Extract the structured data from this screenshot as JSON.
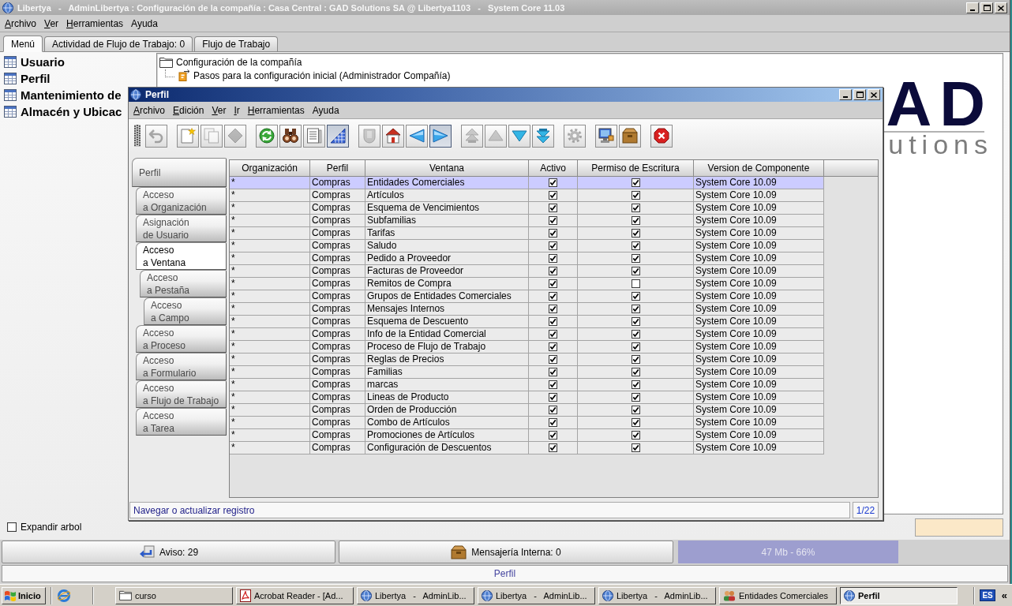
{
  "window": {
    "title": "Libertya   -   AdminLibertya : Configuración de la compañía : Casa Central : GAD Solutions SA @ Libertya1103   -   System Core 11.03",
    "menu": [
      {
        "label": "Archivo",
        "mnemonic": true
      },
      {
        "label": "Ver",
        "mnemonic": true
      },
      {
        "label": "Herramientas",
        "mnemonic": true
      },
      {
        "label": "Ayuda",
        "mnemonic": false
      }
    ]
  },
  "tabs": [
    {
      "label": "Menú",
      "selected": true
    },
    {
      "label": "Actividad de Flujo de Trabajo: 0",
      "selected": false
    },
    {
      "label": "Flujo de Trabajo",
      "selected": false
    }
  ],
  "menu_panel": {
    "favorites": [
      {
        "label": "Usuario"
      },
      {
        "label": "Perfil"
      },
      {
        "label": "Mantenimiento de"
      },
      {
        "label": "Almacén y Ubicac"
      }
    ],
    "tree": [
      {
        "label": "Configuración de la compañía",
        "kind": "folder",
        "children": [
          {
            "label": "Pasos para la configuración inicial (Administrador Compañía)",
            "kind": "process"
          }
        ]
      }
    ],
    "logo": {
      "mark": "AD",
      "tagline": "utions"
    },
    "expand_tree": {
      "label": "Expandir arbol",
      "checked": false
    }
  },
  "status_buttons": [
    {
      "label": "Aviso: 29",
      "kind": "notice"
    },
    {
      "label": "Mensajería Interna: 0",
      "kind": "messages"
    }
  ],
  "memory": {
    "reading": "47 Mb - 66%"
  },
  "status_line": "Perfil",
  "child_window": {
    "title": "Perfil",
    "menu": [
      {
        "label": "Archivo",
        "mnemonic": true
      },
      {
        "label": "Edición",
        "mnemonic": true
      },
      {
        "label": "Ver",
        "mnemonic": true
      },
      {
        "label": "Ir",
        "mnemonic": true
      },
      {
        "label": "Herramientas",
        "mnemonic": true
      },
      {
        "label": "Ayuda",
        "mnemonic": false
      }
    ],
    "toolbar": [
      [
        {
          "kind": "undo",
          "disabled": true,
          "pressed": false
        }
      ],
      [
        {
          "kind": "new",
          "disabled": false,
          "pressed": false
        },
        {
          "kind": "copy",
          "disabled": true,
          "pressed": false
        },
        {
          "kind": "delete",
          "disabled": true,
          "pressed": false
        }
      ],
      [
        {
          "kind": "refresh",
          "disabled": false,
          "pressed": false
        },
        {
          "kind": "find",
          "disabled": false,
          "pressed": false
        },
        {
          "kind": "history",
          "disabled": false,
          "pressed": false
        },
        {
          "kind": "grid",
          "disabled": false,
          "pressed": true
        }
      ],
      [
        {
          "kind": "attachment",
          "disabled": true,
          "pressed": false
        },
        {
          "kind": "home",
          "disabled": false,
          "pressed": false
        },
        {
          "kind": "parent",
          "disabled": false,
          "pressed": false
        },
        {
          "kind": "detail",
          "disabled": false,
          "pressed": true
        }
      ],
      [
        {
          "kind": "first",
          "disabled": true,
          "pressed": false
        },
        {
          "kind": "previous",
          "disabled": true,
          "pressed": false
        },
        {
          "kind": "next",
          "disabled": false,
          "pressed": false
        },
        {
          "kind": "last",
          "disabled": false,
          "pressed": false
        }
      ],
      [
        {
          "kind": "process",
          "disabled": true,
          "pressed": false
        }
      ],
      [
        {
          "kind": "print",
          "disabled": false,
          "pressed": false
        },
        {
          "kind": "archive",
          "disabled": false,
          "pressed": false
        }
      ],
      [
        {
          "kind": "exit",
          "disabled": false,
          "pressed": false
        }
      ]
    ],
    "tabs": [
      {
        "lines": [
          "Perfil"
        ],
        "selected": false,
        "children": [
          {
            "lines": [
              "Acceso",
              "a Organización"
            ],
            "selected": false
          },
          {
            "lines": [
              "Asignación",
              "de Usuario"
            ],
            "selected": false
          },
          {
            "lines": [
              "Acceso",
              "a Ventana"
            ],
            "selected": true,
            "children": [
              {
                "lines": [
                  "Acceso",
                  "a Pestaña"
                ],
                "selected": false,
                "children": [
                  {
                    "lines": [
                      "Acceso",
                      "a Campo"
                    ],
                    "selected": false
                  }
                ]
              }
            ]
          },
          {
            "lines": [
              "Acceso",
              "a Proceso"
            ],
            "selected": false
          },
          {
            "lines": [
              "Acceso",
              "a Formulario"
            ],
            "selected": false
          },
          {
            "lines": [
              "Acceso",
              "a Flujo de Trabajo"
            ],
            "selected": false
          },
          {
            "lines": [
              "Acceso",
              "a Tarea"
            ],
            "selected": false
          }
        ]
      }
    ],
    "table": {
      "columns": [
        {
          "label": "Organización",
          "kind": "text"
        },
        {
          "label": "Perfil",
          "kind": "text"
        },
        {
          "label": "Ventana",
          "kind": "text"
        },
        {
          "label": "Activo",
          "kind": "check"
        },
        {
          "label": "Permiso de Escritura",
          "kind": "check"
        },
        {
          "label": "Version de Componente",
          "kind": "text"
        }
      ],
      "rows": [
        {
          "selected": true,
          "cells": [
            {
              "text": "*"
            },
            {
              "text": "Compras"
            },
            {
              "text": "Entidades Comerciales"
            },
            {
              "checked": true
            },
            {
              "checked": true
            },
            {
              "text": "System Core 10.09"
            }
          ]
        },
        {
          "selected": false,
          "cells": [
            {
              "text": "*"
            },
            {
              "text": "Compras"
            },
            {
              "text": "Artículos"
            },
            {
              "checked": true
            },
            {
              "checked": true
            },
            {
              "text": "System Core 10.09"
            }
          ]
        },
        {
          "selected": false,
          "cells": [
            {
              "text": "*"
            },
            {
              "text": "Compras"
            },
            {
              "text": "Esquema de Vencimientos"
            },
            {
              "checked": true
            },
            {
              "checked": true
            },
            {
              "text": "System Core 10.09"
            }
          ]
        },
        {
          "selected": false,
          "cells": [
            {
              "text": "*"
            },
            {
              "text": "Compras"
            },
            {
              "text": "Subfamilias"
            },
            {
              "checked": true
            },
            {
              "checked": true
            },
            {
              "text": "System Core 10.09"
            }
          ]
        },
        {
          "selected": false,
          "cells": [
            {
              "text": "*"
            },
            {
              "text": "Compras"
            },
            {
              "text": "Tarifas"
            },
            {
              "checked": true
            },
            {
              "checked": true
            },
            {
              "text": "System Core 10.09"
            }
          ]
        },
        {
          "selected": false,
          "cells": [
            {
              "text": "*"
            },
            {
              "text": "Compras"
            },
            {
              "text": "Saludo"
            },
            {
              "checked": true
            },
            {
              "checked": true
            },
            {
              "text": "System Core 10.09"
            }
          ]
        },
        {
          "selected": false,
          "cells": [
            {
              "text": "*"
            },
            {
              "text": "Compras"
            },
            {
              "text": "Pedido a Proveedor"
            },
            {
              "checked": true
            },
            {
              "checked": true
            },
            {
              "text": "System Core 10.09"
            }
          ]
        },
        {
          "selected": false,
          "cells": [
            {
              "text": "*"
            },
            {
              "text": "Compras"
            },
            {
              "text": "Facturas de Proveedor"
            },
            {
              "checked": true
            },
            {
              "checked": true
            },
            {
              "text": "System Core 10.09"
            }
          ]
        },
        {
          "selected": false,
          "cells": [
            {
              "text": "*"
            },
            {
              "text": "Compras"
            },
            {
              "text": "Remitos de Compra"
            },
            {
              "checked": true
            },
            {
              "checked": false
            },
            {
              "text": "System Core 10.09"
            }
          ]
        },
        {
          "selected": false,
          "cells": [
            {
              "text": "*"
            },
            {
              "text": "Compras"
            },
            {
              "text": "Grupos de Entidades Comerciales"
            },
            {
              "checked": true
            },
            {
              "checked": true
            },
            {
              "text": "System Core 10.09"
            }
          ]
        },
        {
          "selected": false,
          "cells": [
            {
              "text": "*"
            },
            {
              "text": "Compras"
            },
            {
              "text": "Mensajes Internos"
            },
            {
              "checked": true
            },
            {
              "checked": true
            },
            {
              "text": "System Core 10.09"
            }
          ]
        },
        {
          "selected": false,
          "cells": [
            {
              "text": "*"
            },
            {
              "text": "Compras"
            },
            {
              "text": "Esquema de Descuento"
            },
            {
              "checked": true
            },
            {
              "checked": true
            },
            {
              "text": "System Core 10.09"
            }
          ]
        },
        {
          "selected": false,
          "cells": [
            {
              "text": "*"
            },
            {
              "text": "Compras"
            },
            {
              "text": "Info de la Entidad Comercial"
            },
            {
              "checked": true
            },
            {
              "checked": true
            },
            {
              "text": "System Core 10.09"
            }
          ]
        },
        {
          "selected": false,
          "cells": [
            {
              "text": "*"
            },
            {
              "text": "Compras"
            },
            {
              "text": "Proceso de Flujo de Trabajo"
            },
            {
              "checked": true
            },
            {
              "checked": true
            },
            {
              "text": "System Core 10.09"
            }
          ]
        },
        {
          "selected": false,
          "cells": [
            {
              "text": "*"
            },
            {
              "text": "Compras"
            },
            {
              "text": "Reglas de Precios"
            },
            {
              "checked": true
            },
            {
              "checked": true
            },
            {
              "text": "System Core 10.09"
            }
          ]
        },
        {
          "selected": false,
          "cells": [
            {
              "text": "*"
            },
            {
              "text": "Compras"
            },
            {
              "text": "Familias"
            },
            {
              "checked": true
            },
            {
              "checked": true
            },
            {
              "text": "System Core 10.09"
            }
          ]
        },
        {
          "selected": false,
          "cells": [
            {
              "text": "*"
            },
            {
              "text": "Compras"
            },
            {
              "text": "marcas"
            },
            {
              "checked": true
            },
            {
              "checked": true
            },
            {
              "text": "System Core 10.09"
            }
          ]
        },
        {
          "selected": false,
          "cells": [
            {
              "text": "*"
            },
            {
              "text": "Compras"
            },
            {
              "text": "Lineas de Producto"
            },
            {
              "checked": true
            },
            {
              "checked": true
            },
            {
              "text": "System Core 10.09"
            }
          ]
        },
        {
          "selected": false,
          "cells": [
            {
              "text": "*"
            },
            {
              "text": "Compras"
            },
            {
              "text": "Orden de Producción"
            },
            {
              "checked": true
            },
            {
              "checked": true
            },
            {
              "text": "System Core 10.09"
            }
          ]
        },
        {
          "selected": false,
          "cells": [
            {
              "text": "*"
            },
            {
              "text": "Compras"
            },
            {
              "text": "Combo de Artículos"
            },
            {
              "checked": true
            },
            {
              "checked": true
            },
            {
              "text": "System Core 10.09"
            }
          ]
        },
        {
          "selected": false,
          "cells": [
            {
              "text": "*"
            },
            {
              "text": "Compras"
            },
            {
              "text": "Promociones de Artículos"
            },
            {
              "checked": true
            },
            {
              "checked": true
            },
            {
              "text": "System Core 10.09"
            }
          ]
        },
        {
          "selected": false,
          "cells": [
            {
              "text": "*"
            },
            {
              "text": "Compras"
            },
            {
              "text": "Configuración de Descuentos"
            },
            {
              "checked": true
            },
            {
              "checked": true
            },
            {
              "text": "System Core 10.09"
            }
          ]
        }
      ]
    },
    "status": {
      "message": "Navegar o actualizar registro",
      "record": "1/22"
    }
  },
  "taskbar": {
    "start": "Inicio",
    "items": [
      {
        "label": "curso",
        "kind": "folder",
        "selected": false
      },
      {
        "label": "Acrobat Reader - [Ad...",
        "kind": "pdf",
        "selected": false
      },
      {
        "label": "Libertya   -   AdminLib...",
        "kind": "app",
        "selected": false
      },
      {
        "label": "Libertya   -   AdminLib...",
        "kind": "app",
        "selected": false
      },
      {
        "label": "Libertya   -   AdminLib...",
        "kind": "app",
        "selected": false
      },
      {
        "label": "Entidades Comerciales",
        "kind": "people",
        "selected": false
      },
      {
        "label": "Perfil",
        "kind": "app",
        "selected": true
      }
    ],
    "language": "ES",
    "tray_toggle": "«"
  }
}
